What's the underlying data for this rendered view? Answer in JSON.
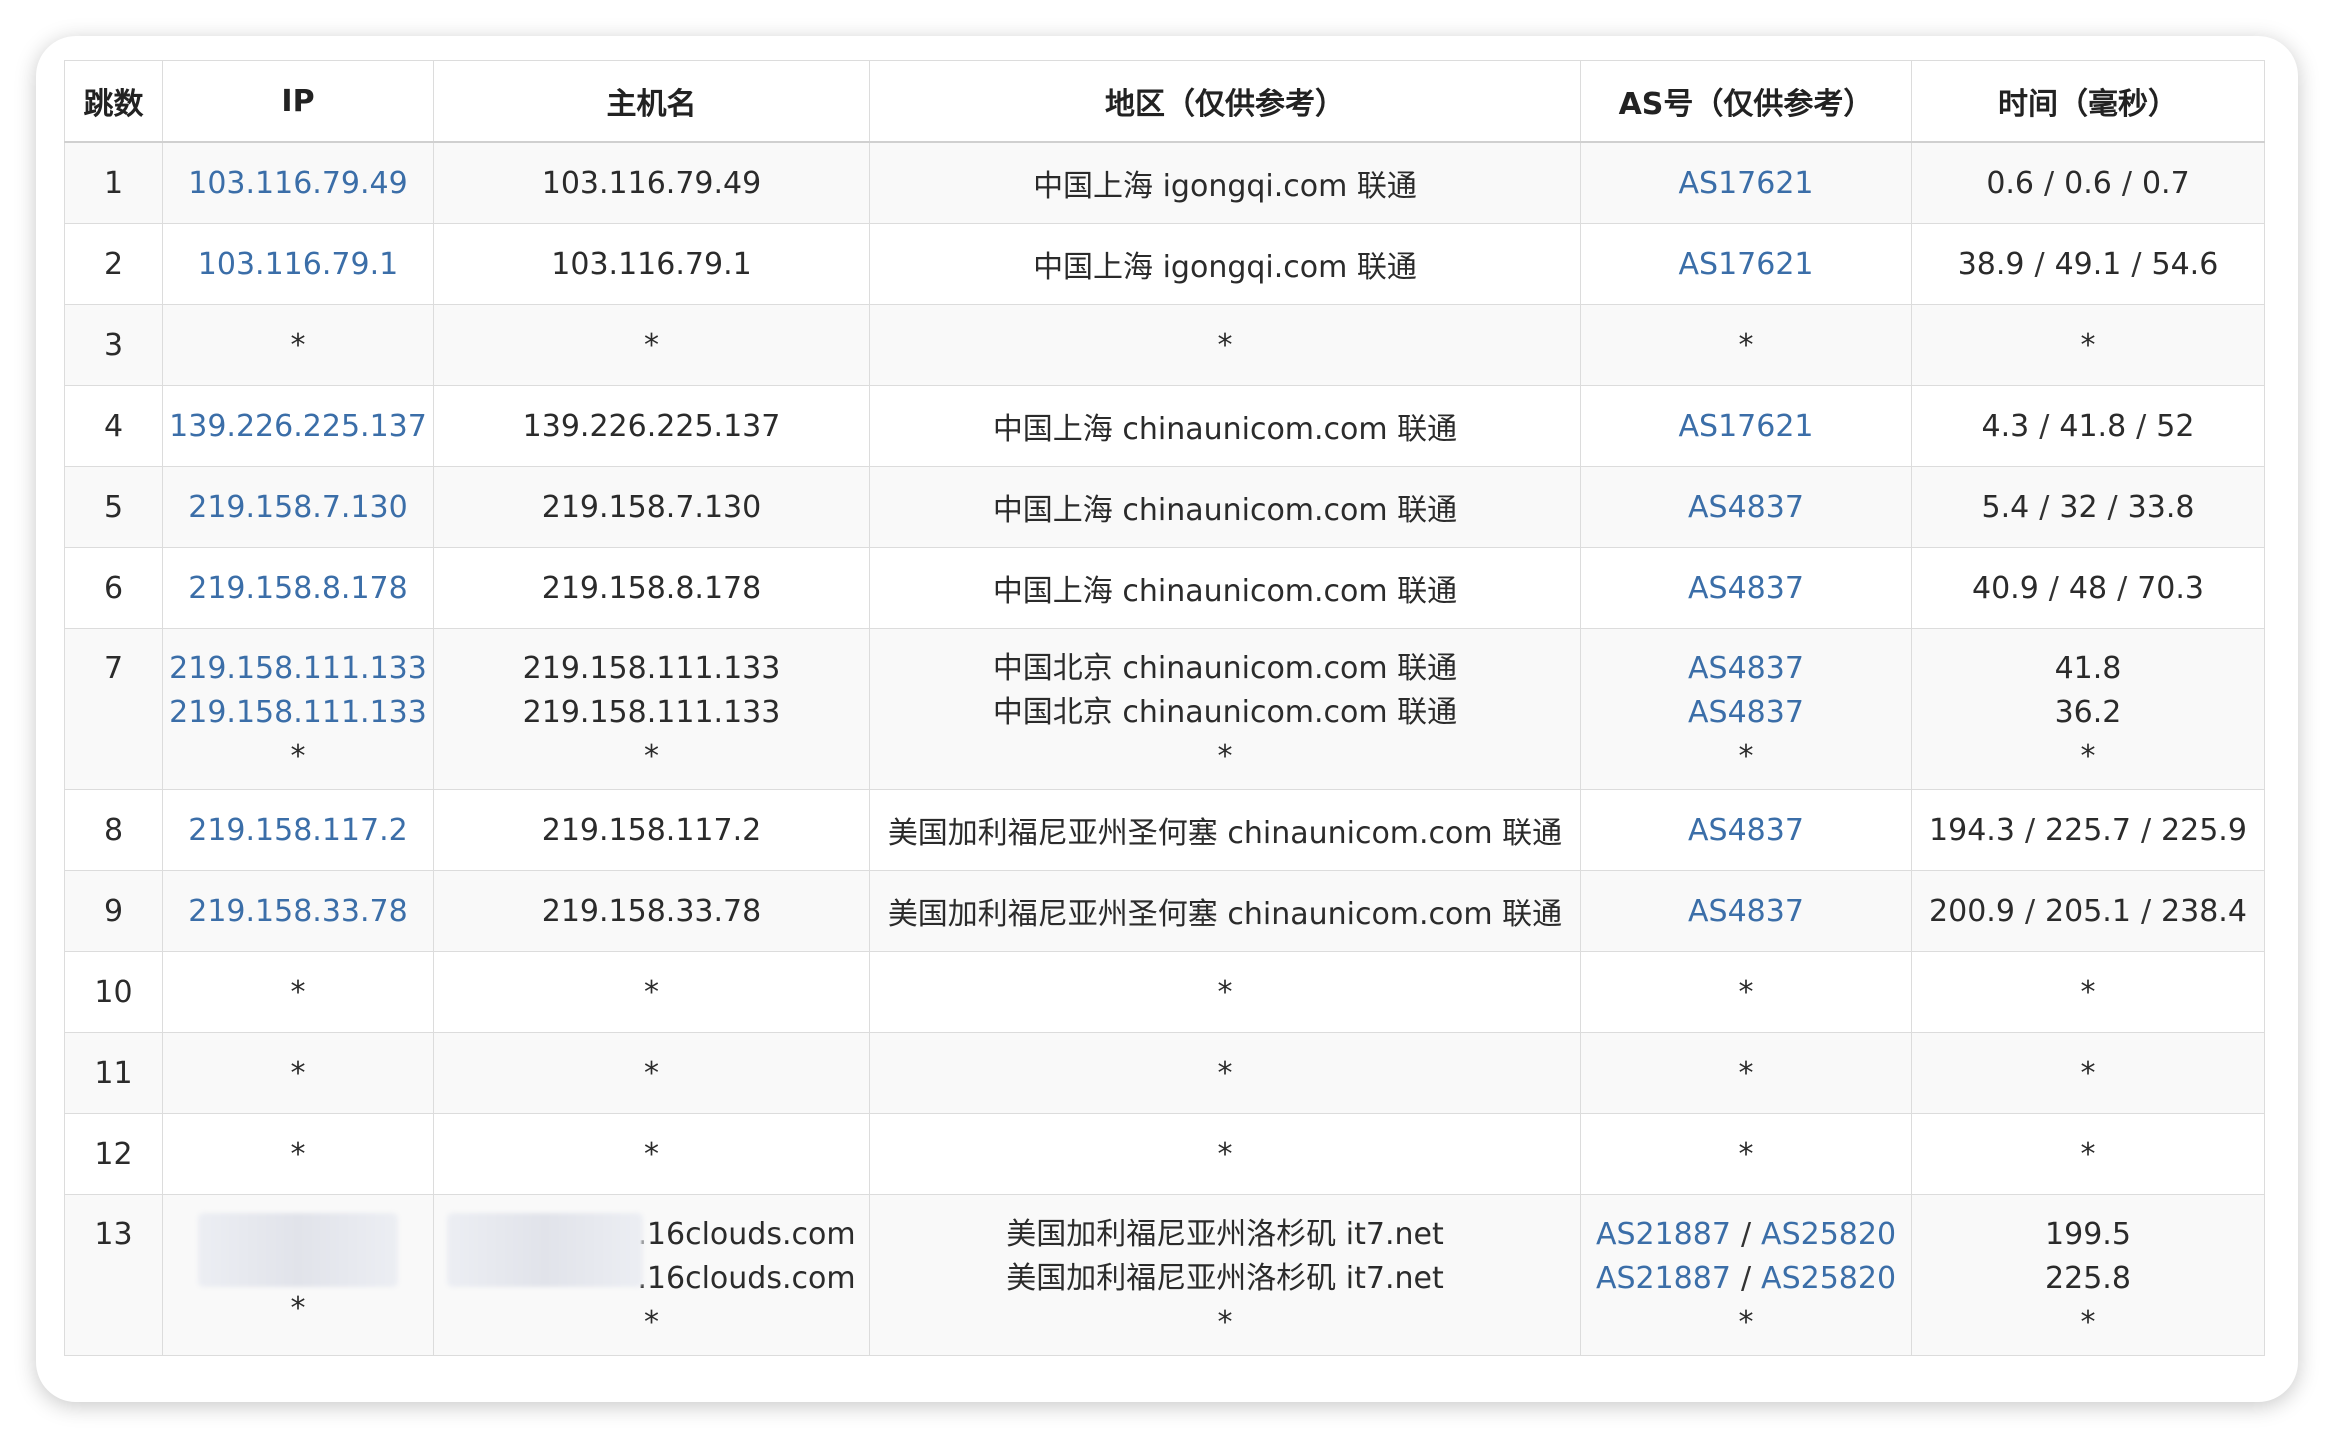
{
  "table": {
    "headers": [
      "跳数",
      "IP",
      "主机名",
      "地区（仅供参考）",
      "AS号（仅供参考）",
      "时间（毫秒）"
    ],
    "rows": [
      {
        "hop": "1",
        "ip": "103.116.79.49",
        "host": "103.116.79.49",
        "region": "中国上海 igongqi.com 联通",
        "as": "AS17621",
        "time": [
          "0.6",
          "0.6",
          "0.7"
        ]
      },
      {
        "hop": "2",
        "ip": "103.116.79.1",
        "host": "103.116.79.1",
        "region": "中国上海 igongqi.com 联通",
        "as": "AS17621",
        "time": [
          "38.9",
          "49.1",
          "54.6"
        ]
      },
      {
        "hop": "3",
        "ip": "*",
        "host": "*",
        "region": "*",
        "as": "*",
        "time_text": "*"
      },
      {
        "hop": "4",
        "ip": "139.226.225.137",
        "host": "139.226.225.137",
        "region": "中国上海 chinaunicom.com 联通",
        "as": "AS17621",
        "time": [
          "4.3",
          "41.8",
          "52"
        ]
      },
      {
        "hop": "5",
        "ip": "219.158.7.130",
        "host": "219.158.7.130",
        "region": "中国上海 chinaunicom.com 联通",
        "as": "AS4837",
        "time": [
          "5.4",
          "32",
          "33.8"
        ]
      },
      {
        "hop": "6",
        "ip": "219.158.8.178",
        "host": "219.158.8.178",
        "region": "中国上海 chinaunicom.com 联通",
        "as": "AS4837",
        "time": [
          "40.9",
          "48",
          "70.3"
        ]
      },
      {
        "hop": "7",
        "ips": [
          "219.158.111.133",
          "219.158.111.133",
          "*"
        ],
        "hosts": [
          "219.158.111.133",
          "219.158.111.133",
          "*"
        ],
        "regions": [
          "中国北京 chinaunicom.com 联通",
          "中国北京 chinaunicom.com 联通",
          "*"
        ],
        "as_list": [
          "AS4837",
          "AS4837",
          "*"
        ],
        "times": [
          "41.8",
          "36.2",
          "*"
        ]
      },
      {
        "hop": "8",
        "ip": "219.158.117.2",
        "host": "219.158.117.2",
        "region": "美国加利福尼亚州圣何塞 chinaunicom.com 联通",
        "as": "AS4837",
        "time": [
          "194.3",
          "225.7",
          "225.9"
        ]
      },
      {
        "hop": "9",
        "ip": "219.158.33.78",
        "host": "219.158.33.78",
        "region": "美国加利福尼亚州圣何塞 chinaunicom.com 联通",
        "as": "AS4837",
        "time": [
          "200.9",
          "205.1",
          "238.4"
        ]
      },
      {
        "hop": "10",
        "ip": "*",
        "host": "*",
        "region": "*",
        "as": "*",
        "time_text": "*"
      },
      {
        "hop": "11",
        "ip": "*",
        "host": "*",
        "region": "*",
        "as": "*",
        "time_text": "*"
      },
      {
        "hop": "12",
        "ip": "*",
        "host": "*",
        "region": "*",
        "as": "*",
        "time_text": "*"
      },
      {
        "hop": "13",
        "ip_last": "*",
        "host_suffixes": [
          ".16clouds.com",
          ".16clouds.com"
        ],
        "host_last": "*",
        "regions": [
          "美国加利福尼亚州洛杉矶 it7.net",
          "美国加利福尼亚州洛杉矶 it7.net",
          "*"
        ],
        "as_pairs": [
          [
            "AS21887",
            "AS25820"
          ],
          [
            "AS21887",
            "AS25820"
          ]
        ],
        "as_last": "*",
        "times": [
          "199.5",
          "225.8",
          "*"
        ]
      }
    ],
    "separator": "/"
  },
  "colors": {
    "link": "#3b6ea8",
    "text": "#2b2b2b",
    "border": "#dcdcdc",
    "stripe": "#f9f9f9"
  }
}
